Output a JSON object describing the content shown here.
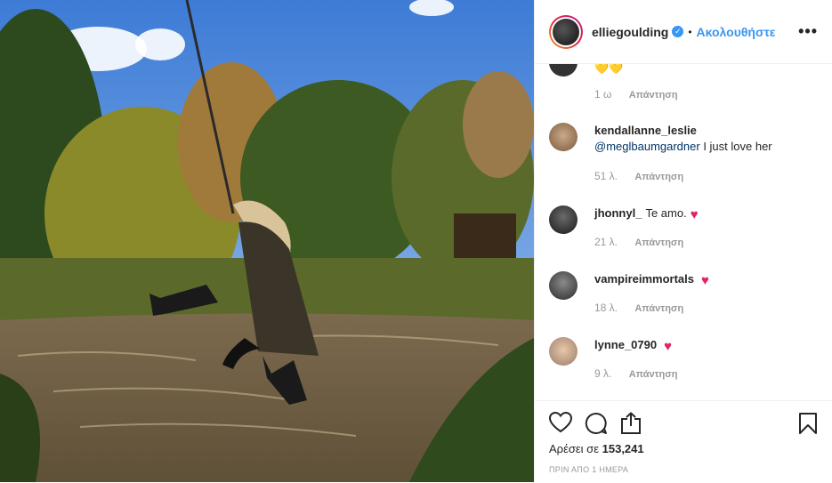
{
  "post": {
    "username": "elliegoulding",
    "follow_label": "Ακολουθήστε",
    "more_icon": "more-options-icon",
    "likes_label": "Αρέσει σε",
    "likes_count": "153,241",
    "date": "ΠΡΙΝ ΑΠΟ 1 ΗΜΕΡΑ"
  },
  "comments": [
    {
      "username": "",
      "text": "💛💛",
      "time": "1 ω",
      "reply": "Απάντηση"
    },
    {
      "username": "kendallanne_leslie",
      "mention": "@meglbaumgardner",
      "text": " I just love her",
      "time": "51 λ.",
      "reply": "Απάντηση"
    },
    {
      "username": "jhonnyl_",
      "text": "Te amo.",
      "time": "21 λ.",
      "reply": "Απάντηση"
    },
    {
      "username": "vampireimmortals",
      "text": "",
      "time": "18 λ.",
      "reply": "Απάντηση"
    },
    {
      "username": "lynne_0790",
      "text": "",
      "time": "9 λ.",
      "reply": "Απάντηση"
    }
  ],
  "icons": [
    "heart-icon",
    "comment-icon",
    "share-icon",
    "bookmark-icon"
  ],
  "colors": {
    "link": "#3897f0",
    "heart": "#e0245e"
  }
}
